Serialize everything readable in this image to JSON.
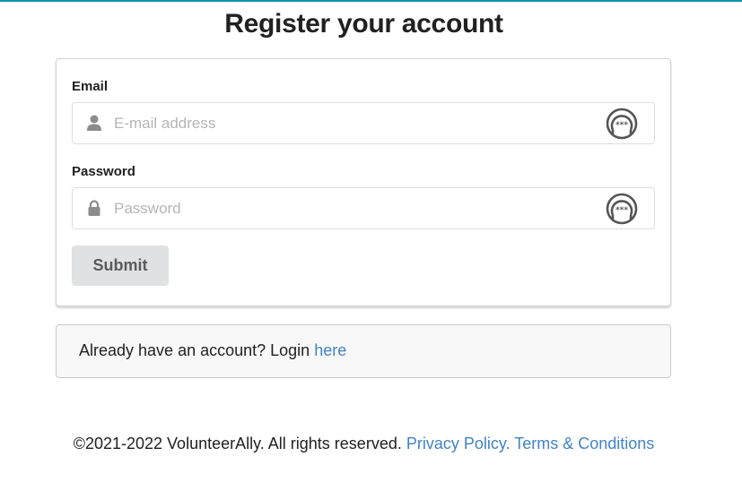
{
  "page": {
    "title": "Register your account"
  },
  "form": {
    "email": {
      "label": "Email",
      "placeholder": "E-mail address",
      "value": ""
    },
    "password": {
      "label": "Password",
      "placeholder": "Password",
      "value": ""
    },
    "submit_label": "Submit"
  },
  "login_prompt": {
    "text": "Already have an account? Login ",
    "link_label": "here"
  },
  "footer": {
    "copyright": "©2021-2022 VolunteerAlly. All rights reserved. ",
    "privacy_label": "Privacy Policy.",
    "terms_label": "Terms & Conditions"
  },
  "icons": {
    "email_field": "user-icon",
    "password_field": "lock-icon",
    "password_manager": "password-manager-icon"
  },
  "colors": {
    "link": "#4183c4",
    "button_bg": "#e0e1e2",
    "top_accent": "#1b8fb0"
  }
}
